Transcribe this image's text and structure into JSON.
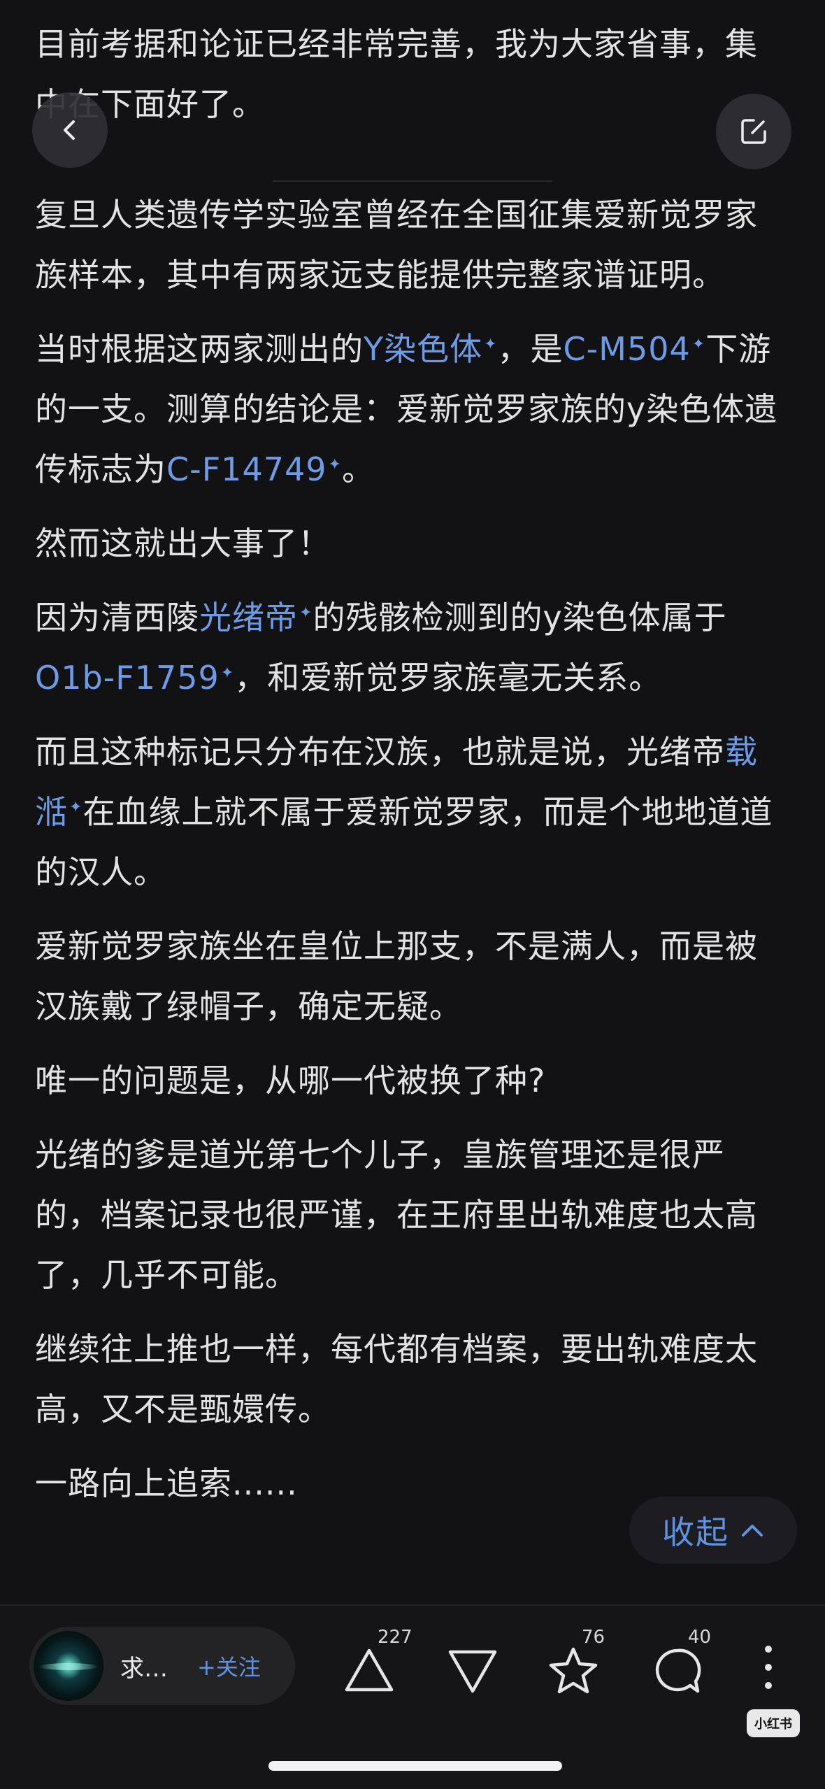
{
  "article": {
    "intro": "目前考据和论证已经非常完善，我为大家省事，集中在下面好了。",
    "p1": "复旦人类遗传学实验室曾经在全国征集爱新觉罗家族样本，其中有两家远支能提供完整家谱证明。",
    "p2": {
      "t1": "当时根据这两家测出的",
      "l1": "Y染色体",
      "t2": "，是",
      "l2": "C-M504",
      "t3": "下游的一支。测算的结论是：爱新觉罗家族的y染色体遗传标志为",
      "l3": "C-F14749",
      "t4": "。"
    },
    "p3": "然而这就出大事了！",
    "p4": {
      "t1": "因为清西陵",
      "l1": "光绪帝",
      "t2": "的残骸检测到的y染色体属于",
      "l2": "O1b-F1759",
      "t3": "，和爱新觉罗家族毫无关系。"
    },
    "p5": {
      "t1": "而且这种标记只分布在汉族，也就是说，光绪帝",
      "l1": "载湉",
      "t2": "在血缘上就不属于爱新觉罗家，而是个地地道道的汉人。"
    },
    "p6": "爱新觉罗家族坐在皇位上那支，不是满人，而是被汉族戴了绿帽子，确定无疑。",
    "p7": "唯一的问题是，从哪一代被换了种?",
    "p8": "光绪的爹是道光第七个儿子，皇族管理还是很严的，档案记录也很严谨，在王府里出轨难度也太高了，几乎不可能。",
    "p9": "继续往上推也一样，每代都有档案，要出轨难度太高，又不是甄嬛传。",
    "p10": "一路向上追索......",
    "link_marker": "✦"
  },
  "collapse": {
    "label": "收起",
    "chevron": "^"
  },
  "author": {
    "name": "求…",
    "follow": "+关注"
  },
  "actions": {
    "likes": "227",
    "stars": "76",
    "comments": "40"
  },
  "watermark": "小红书",
  "colors": {
    "background": "#121214",
    "link": "#6d9be6",
    "accent": "#5f92e0"
  }
}
